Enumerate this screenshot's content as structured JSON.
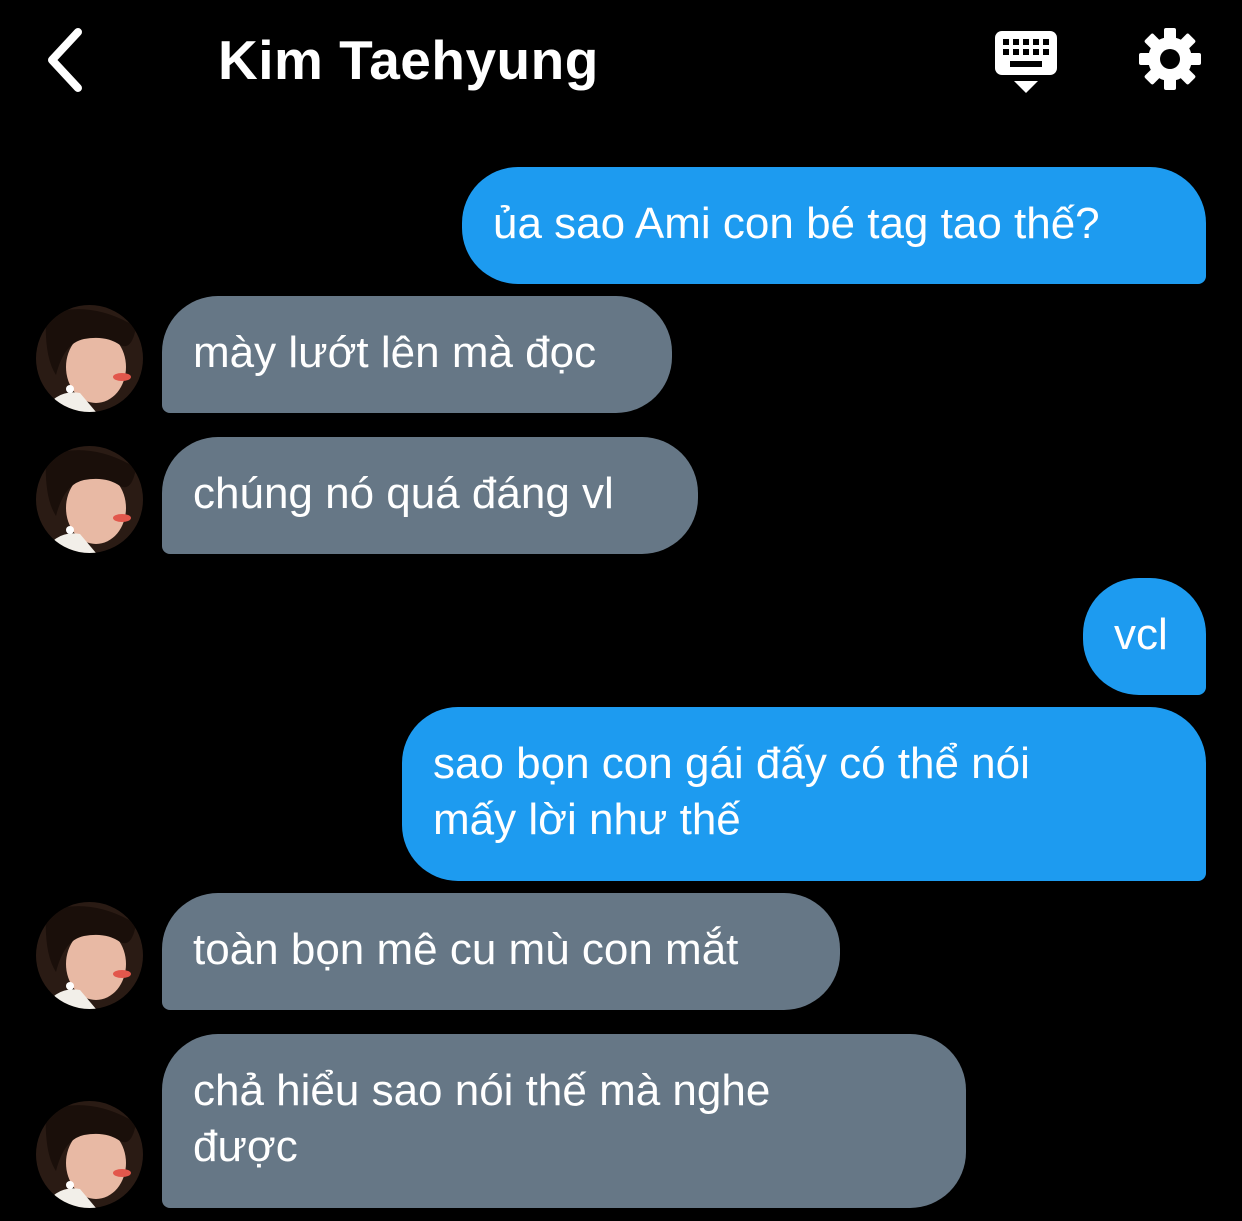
{
  "header": {
    "title": "Kim Taehyung",
    "back_icon": "chevron-left-icon",
    "keyboard_icon": "keyboard-hide-icon",
    "settings_icon": "gear-icon"
  },
  "colors": {
    "background": "#000000",
    "outgoing_bubble": "#1d9bf0",
    "incoming_bubble": "#667786",
    "text": "#ffffff"
  },
  "messages": [
    {
      "direction": "outgoing",
      "text": "ủa sao Ami con bé tag tao thế?"
    },
    {
      "direction": "incoming",
      "text": "mày lướt lên mà đọc"
    },
    {
      "direction": "incoming",
      "text": "chúng nó quá đáng vl"
    },
    {
      "direction": "outgoing",
      "text": "vcl"
    },
    {
      "direction": "outgoing",
      "lines": [
        "sao bọn con gái đấy có thể nói",
        "mấy lời như thế"
      ]
    },
    {
      "direction": "incoming",
      "text": "toàn bọn mê cu mù con mắt"
    },
    {
      "direction": "incoming",
      "lines": [
        "chả hiểu sao nói thế mà nghe",
        "được"
      ]
    }
  ]
}
